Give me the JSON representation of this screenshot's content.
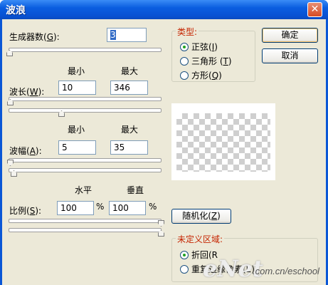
{
  "window": {
    "title": "波浪",
    "close_symbol": "✕"
  },
  "generators": {
    "label": "生成器数(",
    "key": "G",
    "suffix": "):",
    "value": "3",
    "slider_fraction": 0.0
  },
  "minmax": {
    "min": "最小",
    "max": "最大"
  },
  "wavelength": {
    "label": "波长(",
    "key": "W",
    "suffix": "):",
    "min_value": "10",
    "max_value": "346",
    "min_fraction": 0.0,
    "max_fraction": 0.35
  },
  "amplitude": {
    "label": "波幅(",
    "key": "A",
    "suffix": "):",
    "min_value": "5",
    "max_value": "35",
    "min_fraction": 0.0,
    "max_fraction": 0.03
  },
  "scale": {
    "h_header": "水平",
    "v_header": "垂直",
    "label": "比例(",
    "key": "S",
    "suffix": "):",
    "h_value": "100",
    "v_value": "100",
    "percent": "%",
    "h_fraction": 1.0,
    "v_fraction": 1.0
  },
  "type_group": {
    "title": "类型:",
    "options": [
      {
        "text": "正弦(",
        "key": "I",
        "suffix": ")",
        "checked": true
      },
      {
        "text": "三角形 (",
        "key": "T",
        "suffix": ")",
        "checked": false
      },
      {
        "text": "方形(",
        "key": "Q",
        "suffix": ")",
        "checked": false
      }
    ]
  },
  "buttons": {
    "ok": "确定",
    "cancel": "取消",
    "randomize_pre": "随机化(",
    "randomize_key": "Z",
    "randomize_post": ")"
  },
  "undefined_group": {
    "title": "未定义区域:",
    "options": [
      {
        "text": "折回(R",
        "checked": true
      },
      {
        "text": "重复边缘像素(E)",
        "checked": false
      }
    ]
  },
  "watermark": {
    "text": "eNet",
    "site": ".com.cn/eschool"
  },
  "colors": {
    "titlebar": "#0852d4",
    "dialog": "#ece9d8",
    "group_title": "#c52400",
    "button_border": "#003c74"
  }
}
